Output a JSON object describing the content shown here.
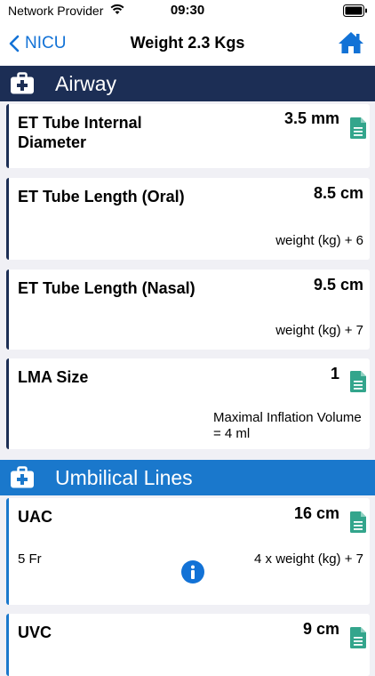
{
  "status_bar": {
    "carrier": "Network Provider",
    "time": "09:30"
  },
  "nav": {
    "back_label": "NICU",
    "title": "Weight 2.3 Kgs"
  },
  "colors": {
    "navy": "#1c2e55",
    "blue": "#1a78cc",
    "teal": "#33a58c",
    "accent": "#1272d6"
  },
  "sections": [
    {
      "title": "Airway",
      "items": [
        {
          "title": "ET Tube Internal Diameter",
          "value": "3.5 mm",
          "formula": "",
          "note": ""
        },
        {
          "title": "ET Tube Length (Oral)",
          "value": "8.5 cm",
          "formula": "weight (kg) + 6",
          "note": ""
        },
        {
          "title": "ET Tube Length (Nasal)",
          "value": "9.5 cm",
          "formula": "weight (kg) + 7",
          "note": ""
        },
        {
          "title": "LMA Size",
          "value": "1",
          "formula": "",
          "note": "Maximal Inflation Volume = 4 ml"
        }
      ]
    },
    {
      "title": "Umbilical Lines",
      "items": [
        {
          "title": "UAC",
          "value": "16 cm",
          "left_text": "5 Fr",
          "formula": "4 x weight (kg) + 7"
        },
        {
          "title": "UVC",
          "value": "9 cm",
          "formula": ""
        }
      ]
    }
  ]
}
